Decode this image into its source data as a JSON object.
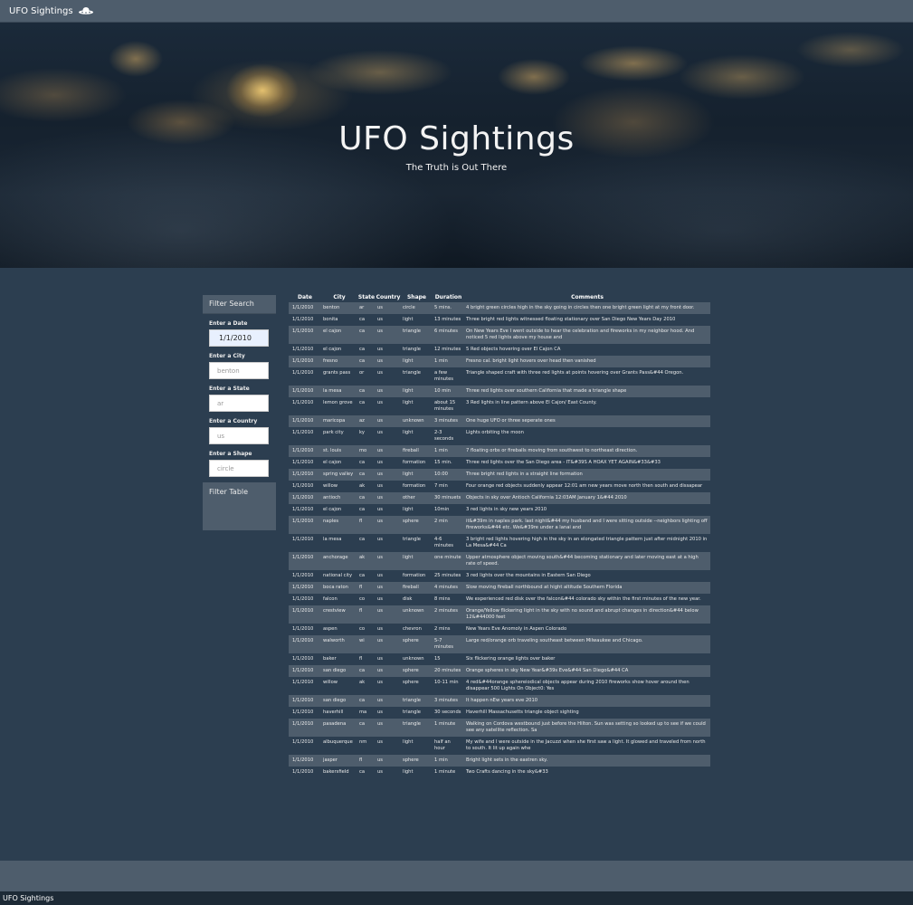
{
  "navbar": {
    "brand": "UFO Sightings"
  },
  "hero": {
    "title": "UFO Sightings",
    "subtitle": "The Truth is Out There"
  },
  "sidebar": {
    "heading": "Filter Search",
    "filters": [
      {
        "label": "Enter a Date",
        "value": "1/1/2010",
        "placeholder": ""
      },
      {
        "label": "Enter a City",
        "value": "",
        "placeholder": "benton"
      },
      {
        "label": "Enter a State",
        "value": "",
        "placeholder": "ar"
      },
      {
        "label": "Enter a Country",
        "value": "",
        "placeholder": "us"
      },
      {
        "label": "Enter a Shape",
        "value": "",
        "placeholder": "circle"
      }
    ],
    "button": "Filter Table"
  },
  "table": {
    "headers": [
      "Date",
      "City",
      "State",
      "Country",
      "Shape",
      "Duration",
      "Comments"
    ],
    "rows": [
      [
        "1/1/2010",
        "benton",
        "ar",
        "us",
        "circle",
        "5 mins.",
        "4 bright green circles high in the sky going in circles then one bright green light at my front door."
      ],
      [
        "1/1/2010",
        "bonita",
        "ca",
        "us",
        "light",
        "13 minutes",
        "Three bright red lights witnessed floating stationary over San Diego New Years Day 2010"
      ],
      [
        "1/1/2010",
        "el cajon",
        "ca",
        "us",
        "triangle",
        "6 minutes",
        "On New Years Eve I went outside to hear the celebration and fireworks in my neighbor hood. And noticed 5 red lights above my house and"
      ],
      [
        "1/1/2010",
        "el cajon",
        "ca",
        "us",
        "triangle",
        "12 minutes",
        "5 Red objects hovering over El Cajon CA"
      ],
      [
        "1/1/2010",
        "fresno",
        "ca",
        "us",
        "light",
        "1 min",
        "Fresno cal. bright light hovers over head then vanished"
      ],
      [
        "1/1/2010",
        "grants pass",
        "or",
        "us",
        "triangle",
        "a few minutes",
        "Triangle shaped craft with three red lights at points hovering over Grants Pass&#44 Oregon."
      ],
      [
        "1/1/2010",
        "la mesa",
        "ca",
        "us",
        "light",
        "10 min",
        "Three red lights over southern California that made a triangle shape"
      ],
      [
        "1/1/2010",
        "lemon grove",
        "ca",
        "us",
        "light",
        "about 15 minutes",
        "3 Red lights in line pattern above El Cajon/ East County."
      ],
      [
        "1/1/2010",
        "maricopa",
        "az",
        "us",
        "unknown",
        "3 minutes",
        "One huge UFO or three seperate ones"
      ],
      [
        "1/1/2010",
        "park city",
        "ky",
        "us",
        "light",
        "2-3 seconds",
        "Lights orbiting the moon"
      ],
      [
        "1/1/2010",
        "st. louis",
        "mo",
        "us",
        "fireball",
        "1 min",
        "7 floating orbs or fireballs moving from southwest to northeast direction."
      ],
      [
        "1/1/2010",
        "el cajon",
        "ca",
        "us",
        "formation",
        "15 min.",
        "Three red lights over the San Diego area - IT&#39S A HOAX YET AGAIN&#33&#33"
      ],
      [
        "1/1/2010",
        "spring valley",
        "ca",
        "us",
        "light",
        "10:00",
        "Three bright red lights in a straight line formation"
      ],
      [
        "1/1/2010",
        "willow",
        "ak",
        "us",
        "formation",
        "7 min",
        "Four orange red objects suddenly appear 12:01 am new years move north then south and dissapear"
      ],
      [
        "1/1/2010",
        "antioch",
        "ca",
        "us",
        "other",
        "30 minuets",
        "Objects in sky over Antioch California 12:03AM January 1&#44 2010"
      ],
      [
        "1/1/2010",
        "el cajon",
        "ca",
        "us",
        "light",
        "10min",
        "3 red lights in sky new years 2010"
      ],
      [
        "1/1/2010",
        "naples",
        "fl",
        "us",
        "sphere",
        "2 min",
        "it&#39m in naples park. last night&#44 my husband and I were sitting outside --neighbors lighting off fireworks&#44 etc. We&#39re under a lanai and"
      ],
      [
        "1/1/2010",
        "la mesa",
        "ca",
        "us",
        "triangle",
        "4-6 minutes",
        "3 bright red lights hovering high in the sky in an elongated triangle pattern just after midnight 2010 in La Mesa&#44 Ca"
      ],
      [
        "1/1/2010",
        "anchorage",
        "ak",
        "us",
        "light",
        "one minute",
        "Upper atmosphere object moving south&#44 becoming stationary and later moving east at a high rate of speed."
      ],
      [
        "1/1/2010",
        "national city",
        "ca",
        "us",
        "formation",
        "25 minutes",
        "3 red lights over the mountains in Eastern San Diego"
      ],
      [
        "1/1/2010",
        "boca raton",
        "fl",
        "us",
        "fireball",
        "4 minutes",
        "Slow moving fireball northbound at hight altitude Southern Florida"
      ],
      [
        "1/1/2010",
        "falcon",
        "co",
        "us",
        "disk",
        "8 mins",
        "We experienced red disk over the falcon&#44 colorado sky within the first minutes of the new year."
      ],
      [
        "1/1/2010",
        "crestview",
        "fl",
        "us",
        "unknown",
        "2 minutes",
        "Orange/Yellow flickering light in the sky with no sound and abrupt changes in direction&#44 below 12&#44000 feet"
      ],
      [
        "1/1/2010",
        "aspen",
        "co",
        "us",
        "chevron",
        "2 mins",
        "New Years Eve Anomoly in Aspen Colorado"
      ],
      [
        "1/1/2010",
        "walworth",
        "wi",
        "us",
        "sphere",
        "5-7 minutes",
        "Large red/orange orb traveling southeast between Milwaukee and Chicago."
      ],
      [
        "1/1/2010",
        "baker",
        "fl",
        "us",
        "unknown",
        "15",
        "Six flickering orange lights over baker"
      ],
      [
        "1/1/2010",
        "san diego",
        "ca",
        "us",
        "sphere",
        "20 minutes",
        "Orange spheres in sky New Year&#39s Eve&#44 San Diego&#44 CA"
      ],
      [
        "1/1/2010",
        "willow",
        "ak",
        "us",
        "sphere",
        "10-11 min",
        "4 red&#44orange sphereiodical objects appear during 2010 fireworks show hover around then disappear 500 Lights On Object0: Yes"
      ],
      [
        "1/1/2010",
        "san diego",
        "ca",
        "us",
        "triangle",
        "3 minutes",
        "It happen nEw years eve 2010"
      ],
      [
        "1/1/2010",
        "haverhill",
        "ma",
        "us",
        "triangle",
        "30 seconds",
        "Haverhill Massachusetts triangle object sighting"
      ],
      [
        "1/1/2010",
        "pasadena",
        "ca",
        "us",
        "triangle",
        "1 minute",
        "Walking on Cordova westbound just before the Hilton. Sun was setting so looked up to see if we could see any satellite reflection. Sa"
      ],
      [
        "1/1/2010",
        "albuquerque",
        "nm",
        "us",
        "light",
        "half an hour",
        "My wife and I were outside in the Jacuzzi when she first saw a light. It glowed and traveled from north to south. It lit up again whe"
      ],
      [
        "1/1/2010",
        "jasper",
        "fl",
        "us",
        "sphere",
        "1 min",
        "Bright light sets in the eastren sky."
      ],
      [
        "1/1/2010",
        "bakersfield",
        "ca",
        "us",
        "light",
        "1 minute",
        "Two Crafts dancing in the sky&#33"
      ]
    ]
  },
  "footer": {
    "text": "UFO Sightings"
  },
  "icons": {
    "brand_icon": "ufo-icon"
  },
  "colors": {
    "background": "#2c3e50",
    "panel": "#4e5d6c",
    "row_stripe": "#4e5d6c",
    "bottom_bar": "#1d2a36"
  }
}
